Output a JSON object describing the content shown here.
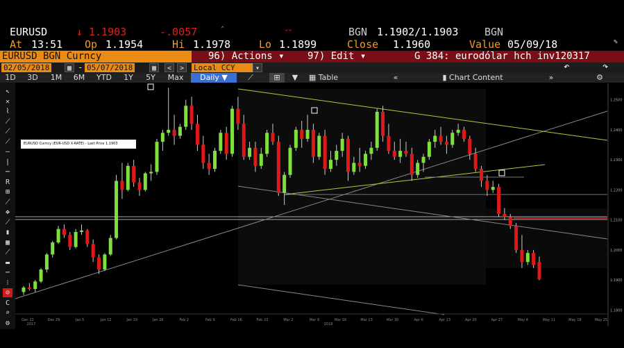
{
  "quote": {
    "ticker": "EURUSD",
    "arrow": "↓",
    "last": "1.1903",
    "change": "-.0057",
    "bgn_label": "BGN",
    "bid_ask": "1.1902/1.1903",
    "bgn_label2": "BGN",
    "at_label": "At",
    "time": "13:51",
    "op_label": "Op",
    "open": "1.1954",
    "hi_label": "Hi",
    "high": "1.1978",
    "lo_label": "Lo",
    "low": "1.1899",
    "close_label": "Close",
    "close": "1.1960",
    "value_label": "Value",
    "value_date": "05/09/18"
  },
  "menu": {
    "security": "EURUSD BGN Curncy",
    "actions": "96) Actions ▾",
    "edit": "97) Edit ▾",
    "chart_name": "G 384: eurodólar hch inv120317"
  },
  "controls": {
    "start_date": "02/05/2018",
    "end_date": "05/07/2018",
    "currency": "Local CCY"
  },
  "periods": [
    "1D",
    "3D",
    "1M",
    "6M",
    "YTD",
    "1Y",
    "5Y",
    "Max"
  ],
  "period_selected": "Daily ▼",
  "view": {
    "table_label": "Table",
    "chart_content_label": "Chart Content"
  },
  "tools": [
    "↖",
    "✕",
    "⌇",
    "⟋",
    "⟋",
    "⟋",
    "―",
    "|",
    "⋯",
    "R",
    "⊞",
    "⟋",
    "✥",
    "⟋",
    "▮",
    "▦",
    "⟋",
    "▬",
    "⋯",
    "⁝",
    "⊘",
    "C",
    "⌕",
    "⚙"
  ],
  "chart_data": {
    "type": "candlestick",
    "legend": "EURUSD Curncy (EUR-USD X-RATE) - Last Price 1.1903",
    "y_ticks": [
      "1.2500",
      "1.2400",
      "1.2300",
      "1.2200",
      "1.2100",
      "1.2000",
      "1.1900",
      "1.1800"
    ],
    "x_ticks": [
      "Dec 22",
      "Dec 29",
      "Jan 5",
      "Jan 12",
      "Jan 19",
      "Jan 26",
      "Feb 2",
      "Feb 9",
      "Feb 16",
      "Feb 23",
      "Mar 2",
      "Mar 9",
      "Mar 16",
      "Mar 23",
      "Mar 30",
      "Apr 6",
      "Apr 13",
      "Apr 20",
      "Apr 27",
      "May 4",
      "May 11",
      "May 18",
      "May 25"
    ],
    "x_year_labels": [
      "2017",
      "2018"
    ],
    "ylim": [
      1.175,
      1.255
    ],
    "candles": [
      [
        1.186,
        1.188,
        1.185,
        1.1875
      ],
      [
        1.1875,
        1.189,
        1.1865,
        1.187
      ],
      [
        1.187,
        1.19,
        1.186,
        1.1895
      ],
      [
        1.1895,
        1.194,
        1.189,
        1.1935
      ],
      [
        1.1935,
        1.199,
        1.1925,
        1.1985
      ],
      [
        1.1985,
        1.203,
        1.1975,
        1.2025
      ],
      [
        1.2025,
        1.208,
        1.202,
        1.207
      ],
      [
        1.207,
        1.2085,
        1.204,
        1.205
      ],
      [
        1.205,
        1.206,
        1.2,
        1.201
      ],
      [
        1.201,
        1.207,
        1.2005,
        1.206
      ],
      [
        1.206,
        1.2085,
        1.205,
        1.2065
      ],
      [
        1.2065,
        1.207,
        1.201,
        1.202
      ],
      [
        1.202,
        1.2035,
        1.196,
        1.1975
      ],
      [
        1.1975,
        1.1985,
        1.192,
        1.1935
      ],
      [
        1.1935,
        1.199,
        1.193,
        1.1985
      ],
      [
        1.1985,
        1.205,
        1.198,
        1.204
      ],
      [
        1.204,
        1.225,
        1.2035,
        1.223
      ],
      [
        1.223,
        1.229,
        1.217,
        1.22
      ],
      [
        1.22,
        1.229,
        1.2195,
        1.228
      ],
      [
        1.228,
        1.23,
        1.221,
        1.2225
      ],
      [
        1.2225,
        1.224,
        1.218,
        1.22
      ],
      [
        1.22,
        1.226,
        1.2195,
        1.2255
      ],
      [
        1.2255,
        1.2285,
        1.223,
        1.226
      ],
      [
        1.226,
        1.237,
        1.225,
        1.236
      ],
      [
        1.236,
        1.24,
        1.233,
        1.239
      ],
      [
        1.239,
        1.254,
        1.238,
        1.24
      ],
      [
        1.24,
        1.245,
        1.235,
        1.238
      ],
      [
        1.238,
        1.242,
        1.237,
        1.241
      ],
      [
        1.241,
        1.25,
        1.24,
        1.248
      ],
      [
        1.248,
        1.251,
        1.24,
        1.242
      ],
      [
        1.242,
        1.245,
        1.233,
        1.235
      ],
      [
        1.235,
        1.238,
        1.227,
        1.229
      ],
      [
        1.229,
        1.232,
        1.225,
        1.227
      ],
      [
        1.227,
        1.234,
        1.226,
        1.233
      ],
      [
        1.233,
        1.24,
        1.232,
        1.239
      ],
      [
        1.239,
        1.241,
        1.23,
        1.232
      ],
      [
        1.232,
        1.248,
        1.231,
        1.247
      ],
      [
        1.247,
        1.251,
        1.24,
        1.242
      ],
      [
        1.242,
        1.245,
        1.23,
        1.231
      ],
      [
        1.231,
        1.236,
        1.23,
        1.234
      ],
      [
        1.234,
        1.236,
        1.226,
        1.228
      ],
      [
        1.228,
        1.234,
        1.227,
        1.232
      ],
      [
        1.232,
        1.24,
        1.231,
        1.239
      ],
      [
        1.239,
        1.242,
        1.235,
        1.236
      ],
      [
        1.236,
        1.238,
        1.218,
        1.219
      ],
      [
        1.219,
        1.226,
        1.215,
        1.225
      ],
      [
        1.225,
        1.235,
        1.224,
        1.234
      ],
      [
        1.234,
        1.241,
        1.233,
        1.24
      ],
      [
        1.24,
        1.243,
        1.234,
        1.237
      ],
      [
        1.237,
        1.245,
        1.236,
        1.24
      ],
      [
        1.24,
        1.242,
        1.229,
        1.231
      ],
      [
        1.231,
        1.239,
        1.23,
        1.238
      ],
      [
        1.238,
        1.24,
        1.225,
        1.227
      ],
      [
        1.227,
        1.233,
        1.226,
        1.23
      ],
      [
        1.23,
        1.235,
        1.228,
        1.233
      ],
      [
        1.233,
        1.239,
        1.231,
        1.237
      ],
      [
        1.237,
        1.238,
        1.223,
        1.226
      ],
      [
        1.226,
        1.231,
        1.225,
        1.229
      ],
      [
        1.229,
        1.234,
        1.226,
        1.228
      ],
      [
        1.228,
        1.233,
        1.227,
        1.232
      ],
      [
        1.232,
        1.236,
        1.23,
        1.234
      ],
      [
        1.234,
        1.247,
        1.233,
        1.246
      ],
      [
        1.246,
        1.248,
        1.236,
        1.238
      ],
      [
        1.238,
        1.242,
        1.232,
        1.233
      ],
      [
        1.233,
        1.236,
        1.23,
        1.231
      ],
      [
        1.231,
        1.237,
        1.229,
        1.233
      ],
      [
        1.233,
        1.236,
        1.231,
        1.232
      ],
      [
        1.232,
        1.234,
        1.223,
        1.225
      ],
      [
        1.225,
        1.23,
        1.224,
        1.229
      ],
      [
        1.229,
        1.232,
        1.226,
        1.231
      ],
      [
        1.231,
        1.237,
        1.23,
        1.236
      ],
      [
        1.236,
        1.24,
        1.234,
        1.238
      ],
      [
        1.238,
        1.241,
        1.235,
        1.236
      ],
      [
        1.236,
        1.238,
        1.232,
        1.235
      ],
      [
        1.235,
        1.24,
        1.234,
        1.239
      ],
      [
        1.239,
        1.242,
        1.238,
        1.24
      ],
      [
        1.24,
        1.241,
        1.236,
        1.237
      ],
      [
        1.237,
        1.238,
        1.23,
        1.232
      ],
      [
        1.232,
        1.234,
        1.226,
        1.227
      ],
      [
        1.227,
        1.228,
        1.221,
        1.223
      ],
      [
        1.223,
        1.225,
        1.218,
        1.22
      ],
      [
        1.22,
        1.223,
        1.219,
        1.221
      ],
      [
        1.221,
        1.222,
        1.211,
        1.212
      ],
      [
        1.212,
        1.214,
        1.21,
        1.211
      ],
      [
        1.211,
        1.212,
        1.207,
        1.208
      ],
      [
        1.208,
        1.209,
        1.199,
        1.2
      ],
      [
        1.2,
        1.205,
        1.194,
        1.196
      ],
      [
        1.196,
        1.2,
        1.195,
        1.199
      ],
      [
        1.199,
        1.2,
        1.194,
        1.195
      ],
      [
        1.196,
        1.1978,
        1.1899,
        1.1903
      ]
    ]
  }
}
